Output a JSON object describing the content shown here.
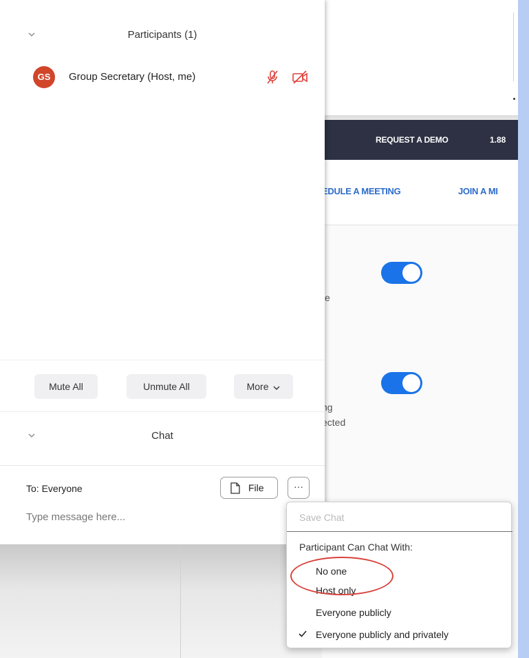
{
  "background_page": {
    "nav": {
      "request_demo": "REQUEST A DEMO",
      "phone": "1.88"
    },
    "subnav": {
      "schedule": "EDULE A MEETING",
      "join": "JOIN A MI"
    },
    "setting1_fragment": "e",
    "setting2_fragment_line1": "ng",
    "setting2_fragment_line2": "ected",
    "toggle1_on": true,
    "toggle2_on": true
  },
  "participants": {
    "title": "Participants (1)",
    "list": [
      {
        "initials": "GS",
        "name": "Group Secretary (Host, me)",
        "audio": "muted",
        "video": "off"
      }
    ],
    "buttons": {
      "mute_all": "Mute All",
      "unmute_all": "Unmute All",
      "more": "More"
    }
  },
  "chat": {
    "title": "Chat",
    "to_label": "To: Everyone",
    "file_button": "File",
    "more_button": "···",
    "input_placeholder": "Type message here..."
  },
  "chat_menu": {
    "save_chat": "Save Chat",
    "heading": "Participant Can Chat With:",
    "options": [
      {
        "label": "No one",
        "checked": false
      },
      {
        "label": "Host only",
        "checked": false
      },
      {
        "label": "Everyone publicly",
        "checked": false
      },
      {
        "label": "Everyone publicly and privately",
        "checked": true
      }
    ]
  },
  "colors": {
    "avatar": "#d1452b",
    "accent": "#1a73e8",
    "navbar": "#2d3143",
    "link": "#2d6ccb",
    "annotation": "#d8423a"
  }
}
